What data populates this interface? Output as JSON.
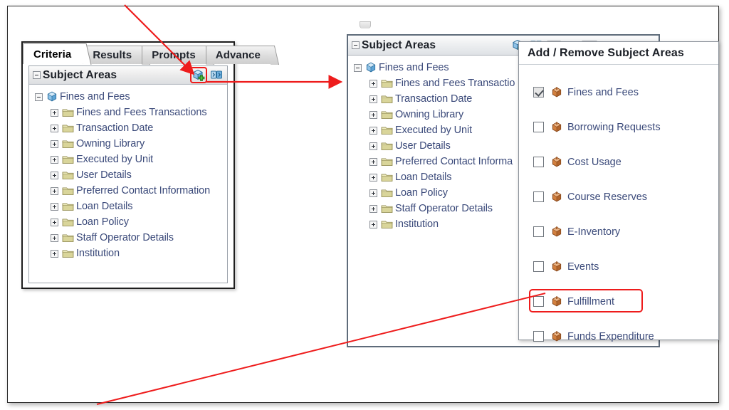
{
  "left_panel": {
    "tabs": [
      {
        "label": "Criteria",
        "active": true
      },
      {
        "label": "Results",
        "active": false
      },
      {
        "label": "Prompts",
        "active": false
      },
      {
        "label": "Advance",
        "active": false
      }
    ],
    "section_title": "Subject Areas",
    "toolbar": [
      {
        "name": "add-subject-area-icon",
        "highlighted": true
      },
      {
        "name": "show-hide-panel-icon",
        "highlighted": false
      }
    ],
    "tree": {
      "root": "Fines and Fees",
      "children": [
        "Fines and Fees Transactions",
        "Transaction Date",
        "Owning Library",
        "Executed by Unit",
        "User Details",
        "Preferred Contact Information",
        "Loan Details",
        "Loan Policy",
        "Staff Operator Details",
        "Institution"
      ]
    }
  },
  "middle_panel": {
    "section_title": "Subject Areas",
    "tree": {
      "root": "Fines and Fees",
      "children": [
        "Fines and Fees Transactio",
        "Transaction Date",
        "Owning Library",
        "Executed by Unit",
        "User Details",
        "Preferred Contact Informa",
        "Loan Details",
        "Loan Policy",
        "Staff Operator Details",
        "Institution"
      ]
    }
  },
  "dialog": {
    "title": "Add / Remove Subject Areas",
    "items": [
      {
        "label": "Fines and Fees",
        "checked": true,
        "highlighted": false
      },
      {
        "label": "Borrowing Requests",
        "checked": false,
        "highlighted": false
      },
      {
        "label": "Cost Usage",
        "checked": false,
        "highlighted": false
      },
      {
        "label": "Course Reserves",
        "checked": false,
        "highlighted": false
      },
      {
        "label": "E-Inventory",
        "checked": false,
        "highlighted": false
      },
      {
        "label": "Events",
        "checked": false,
        "highlighted": false
      },
      {
        "label": "Fulfillment",
        "checked": false,
        "highlighted": true
      },
      {
        "label": "Funds Expenditure",
        "checked": false,
        "highlighted": false
      }
    ]
  },
  "annotations": {
    "accent_color": "#ee1c1c",
    "arrows": [
      {
        "name": "arrow-to-add-icon"
      },
      {
        "name": "arrow-to-middle-panel"
      },
      {
        "name": "line-from-fulfillment"
      }
    ]
  }
}
